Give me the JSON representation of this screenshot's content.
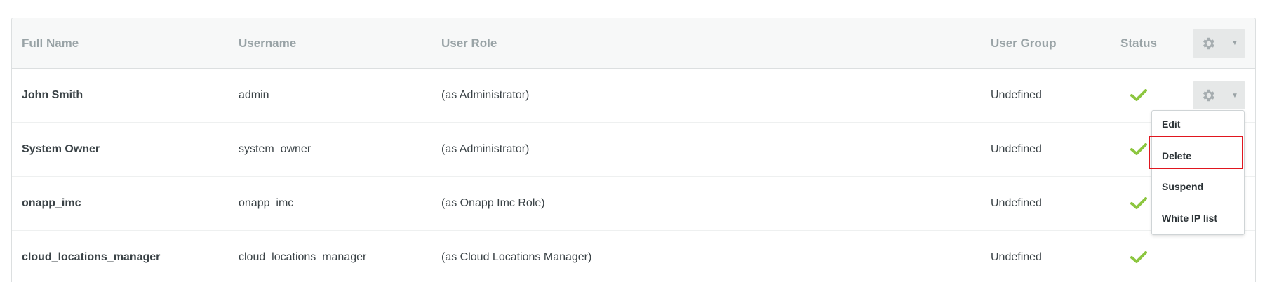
{
  "table": {
    "headers": {
      "full_name": "Full Name",
      "username": "Username",
      "user_role": "User Role",
      "user_group": "User Group",
      "status": "Status"
    },
    "rows": [
      {
        "full_name": "John Smith",
        "username": "admin",
        "user_role": "(as Administrator)",
        "user_group": "Undefined",
        "status": "active"
      },
      {
        "full_name": "System Owner",
        "username": "system_owner",
        "user_role": "(as Administrator)",
        "user_group": "Undefined",
        "status": "active"
      },
      {
        "full_name": "onapp_imc",
        "username": "onapp_imc",
        "user_role": "(as Onapp Imc Role)",
        "user_group": "Undefined",
        "status": "active"
      },
      {
        "full_name": "cloud_locations_manager",
        "username": "cloud_locations_manager",
        "user_role": "(as Cloud Locations Manager)",
        "user_group": "Undefined",
        "status": "active"
      }
    ]
  },
  "dropdown": {
    "items": [
      "Edit",
      "Delete",
      "Suspend",
      "White IP list"
    ]
  },
  "colors": {
    "check": "#8cc63f",
    "highlight": "#e0161f",
    "header_bg": "#f7f8f8",
    "header_text": "#99a3a6"
  }
}
